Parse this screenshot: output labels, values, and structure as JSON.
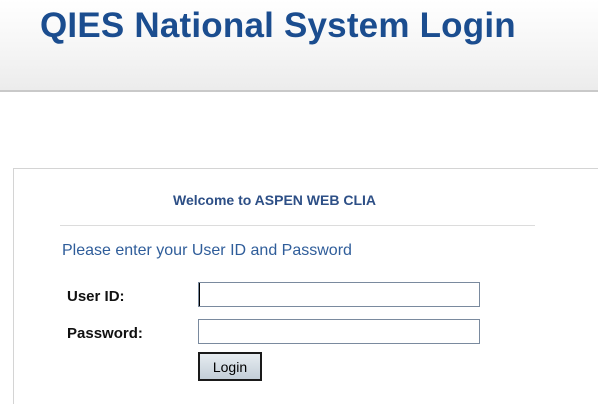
{
  "header": {
    "title": "QIES National System Login"
  },
  "login_panel": {
    "welcome": "Welcome to ASPEN WEB CLIA",
    "prompt": "Please enter your User ID and Password",
    "user_id_label": "User ID:",
    "user_id_value": "",
    "password_label": "Password:",
    "password_value": "",
    "login_button": "Login"
  },
  "colors": {
    "title": "#1b4d8f",
    "welcome": "#2d4f86",
    "prompt": "#2f5d9a",
    "button_bg": "#c3ced8"
  }
}
